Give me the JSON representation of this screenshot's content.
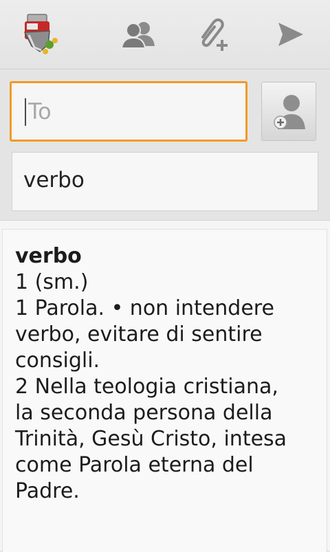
{
  "actionbar": {
    "app_icon": "dictionary-app-icon",
    "contacts_icon": "contacts-icon",
    "attach_icon": "attach-plus-icon",
    "send_icon": "send-icon"
  },
  "compose": {
    "to_placeholder": "To",
    "to_value": "",
    "add_contact_icon": "add-contact-icon",
    "subject": "verbo"
  },
  "body": {
    "headword": "verbo",
    "lines": [
      "1 (sm.)",
      "1 Parola. • non intendere",
      "verbo, evitare di sentire",
      "consigli.",
      "2 Nella teologia cristiana,",
      "la seconda persona della",
      "Trinità, Gesù Cristo, intesa",
      "come Parola eterna del",
      "Padre."
    ]
  },
  "colors": {
    "focus_border": "#f29a24",
    "icon_gray": "#8a8a8a",
    "background": "#e6e6e6"
  }
}
